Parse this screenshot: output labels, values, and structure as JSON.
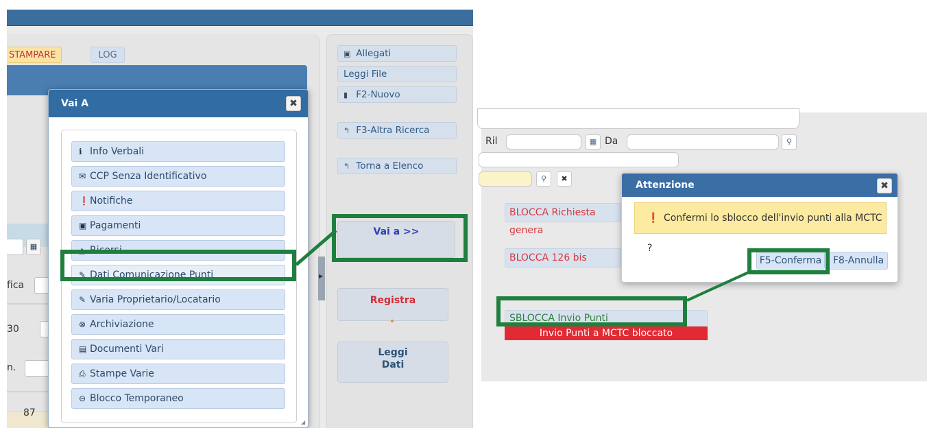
{
  "left": {
    "toolbar": {
      "stampare_label": "STAMPARE",
      "log_label": "LOG"
    },
    "side_labels": {
      "fica": "fica",
      "num": "30",
      "n": "n."
    },
    "bottom_value": "87",
    "actions": [
      {
        "icon": "paperclip-icon",
        "glyph": "🖇",
        "label": "Allegati"
      },
      {
        "icon": "",
        "glyph": "",
        "label": "Leggi File"
      },
      {
        "icon": "new-file-icon",
        "glyph": "▮",
        "label": "F2-Nuovo"
      },
      {
        "icon": "back-arrow-icon",
        "glyph": "↰",
        "label": "F3-Altra Ricerca"
      },
      {
        "icon": "back-arrow-icon",
        "glyph": "↰",
        "label": "Torna a Elenco"
      }
    ],
    "vai_a_button": "Vai a >>",
    "registra_button": "Registra",
    "leggi_dati_button_line1": "Leggi",
    "leggi_dati_button_line2": "Dati",
    "dialog": {
      "title": "Vai A",
      "close_glyph": "✖",
      "items": [
        {
          "icon": "info-icon",
          "glyph": "ℹ",
          "label": "Info Verbali"
        },
        {
          "icon": "envelope-icon",
          "glyph": "✉",
          "label": "CCP Senza Identificativo"
        },
        {
          "icon": "exclamation-icon",
          "glyph": "❗",
          "label": "Notifiche"
        },
        {
          "icon": "inbox-icon",
          "glyph": "▣",
          "label": "Pagamenti"
        },
        {
          "icon": "warning-icon",
          "glyph": "▲",
          "label": "Ricorsi"
        },
        {
          "icon": "pencil-icon",
          "glyph": "✎",
          "label": "Dati Comunicazione Punti"
        },
        {
          "icon": "pencil-icon",
          "glyph": "✎",
          "label": "Varia Proprietario/Locatario"
        },
        {
          "icon": "times-circle-icon",
          "glyph": "⊗",
          "label": "Archiviazione"
        },
        {
          "icon": "documents-icon",
          "glyph": "▤",
          "label": "Documenti Vari"
        },
        {
          "icon": "print-icon",
          "glyph": "⎙",
          "label": "Stampe Varie"
        },
        {
          "icon": "minus-circle-icon",
          "glyph": "⊖",
          "label": "Blocco Temporaneo"
        }
      ]
    }
  },
  "right": {
    "ril_label": "Ril",
    "da_label": "Da",
    "blocca_richiesta": "BLOCCA Richiesta genera",
    "blocca_126": "BLOCCA 126 bis",
    "sblocca": "SBLOCCA Invio Punti",
    "status_bar": "Invio Punti a MCTC bloccato",
    "dialog": {
      "title": "Attenzione",
      "close_glyph": "✖",
      "message": "Confermi lo sblocco dell'invio punti alla MCTC ?",
      "confirm": "F5-Conferma",
      "cancel": "F8-Annulla"
    }
  },
  "colors": {
    "highlight": "#1f7f3e",
    "dialog_header": "#316ca3",
    "alert": "#e12a33"
  }
}
